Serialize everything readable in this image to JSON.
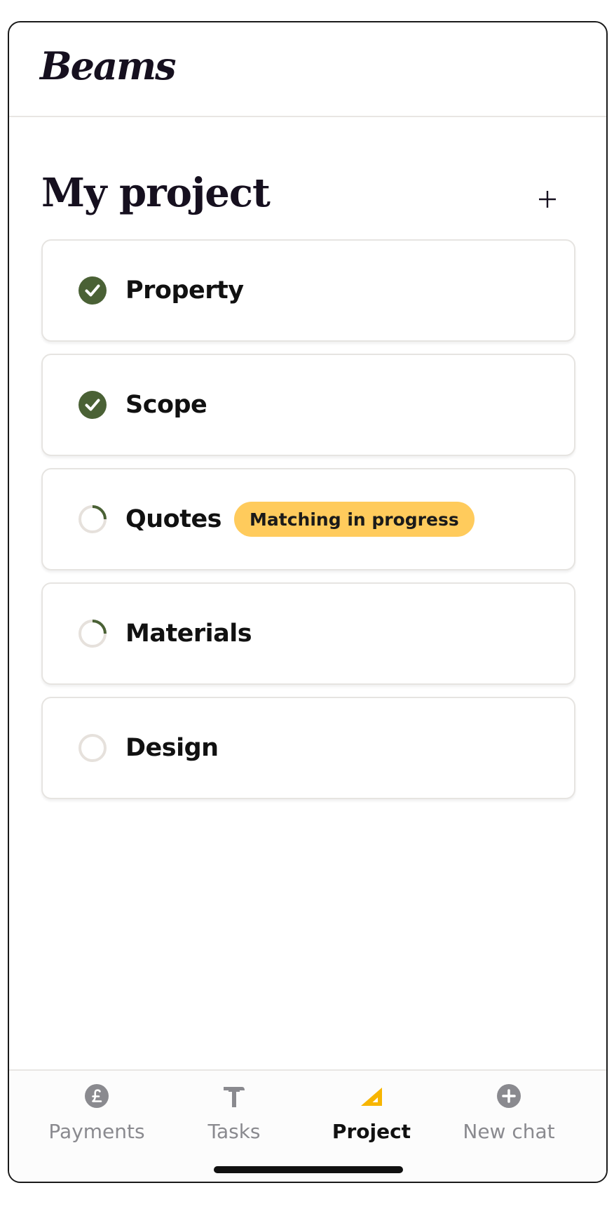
{
  "app": {
    "logo_text": "Beams"
  },
  "page": {
    "title": "My project"
  },
  "colors": {
    "accent_green": "#4a6135",
    "badge_yellow": "#ffcb5c",
    "tab_active_icon": "#f7b500",
    "tab_inactive": "#8a8a8f",
    "ring_grey": "#e6e1dc"
  },
  "steps": [
    {
      "label": "Property",
      "status": "complete",
      "icon": "check-circle-icon"
    },
    {
      "label": "Scope",
      "status": "complete",
      "icon": "check-circle-icon"
    },
    {
      "label": "Quotes",
      "status": "in-progress",
      "icon": "progress-ring-icon",
      "badge": "Matching in progress"
    },
    {
      "label": "Materials",
      "status": "in-progress",
      "icon": "progress-ring-icon"
    },
    {
      "label": "Design",
      "status": "not-started",
      "icon": "empty-ring-icon"
    }
  ],
  "tabbar": {
    "tabs": [
      {
        "label": "Payments",
        "icon": "pound-coin-icon",
        "active": false
      },
      {
        "label": "Tasks",
        "icon": "hammer-icon",
        "active": false
      },
      {
        "label": "Project",
        "icon": "set-square-icon",
        "active": true
      },
      {
        "label": "New chat",
        "icon": "plus-circle-icon",
        "active": false
      }
    ]
  }
}
